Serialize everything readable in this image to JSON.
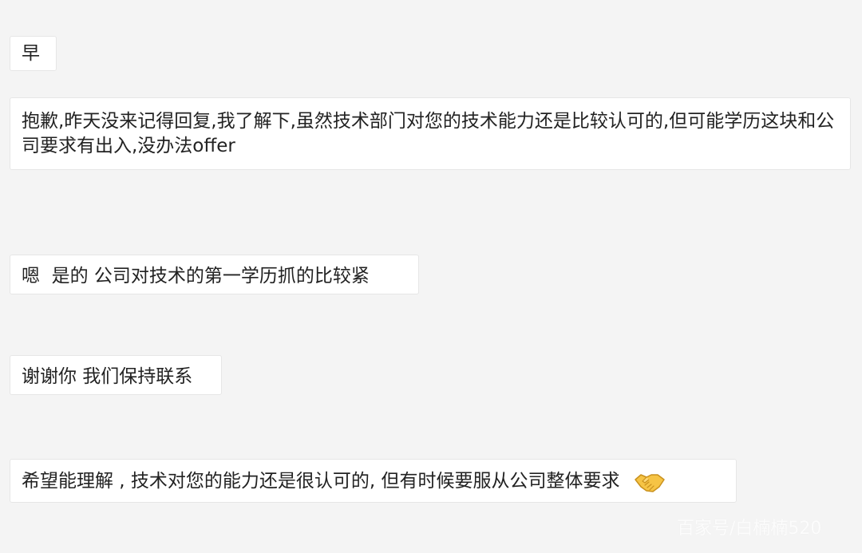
{
  "messages": [
    {
      "text": "早"
    },
    {
      "text": "抱歉,昨天没来记得回复,我了解下,虽然技术部门对您的技术能力还是比较认可的,但可能学历这块和公司要求有出入,没办法offer"
    },
    {
      "text": "嗯  是的 公司对技术的第一学历抓的比较紧"
    },
    {
      "text": "谢谢你 我们保持联系"
    },
    {
      "text": "希望能理解 , 技术对您的能力还是很认可的, 但有时候要服从公司整体要求",
      "emoji": "handshake-icon"
    }
  ],
  "watermark": "百家号/白楠楠520",
  "colors": {
    "background": "#f4f4f4",
    "bubble": "#ffffff",
    "text": "#222222"
  }
}
